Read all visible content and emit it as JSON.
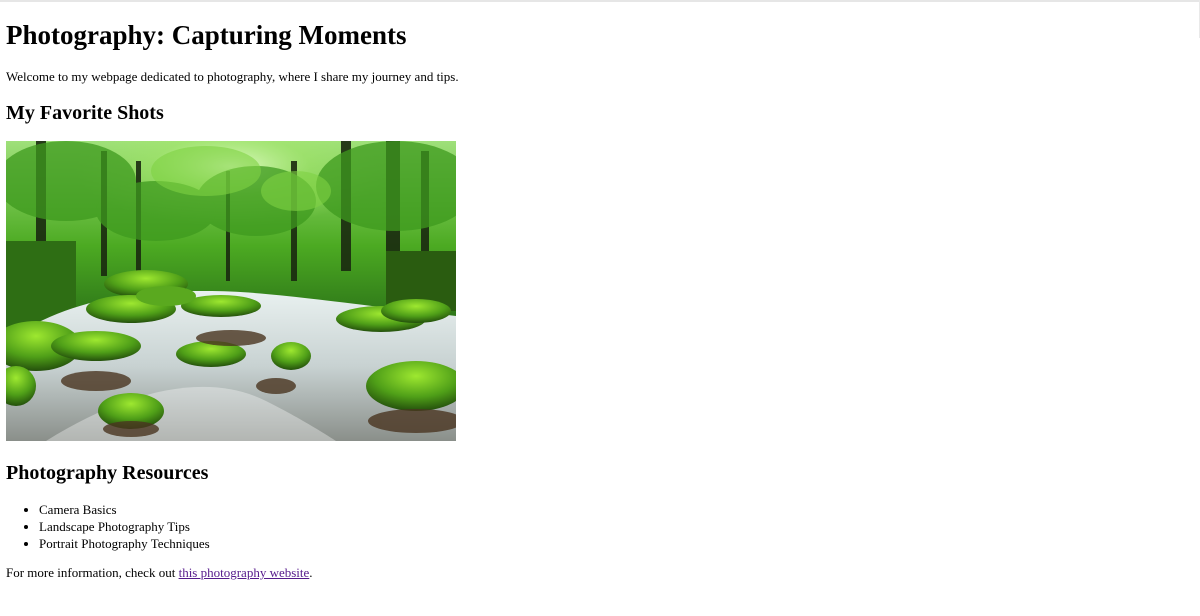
{
  "page": {
    "title": "Photography: Capturing Moments",
    "intro": "Welcome to my webpage dedicated to photography, where I share my journey and tips."
  },
  "favorites": {
    "heading": "My Favorite Shots",
    "image": {
      "subject": "forest-stream",
      "colors": {
        "canopy": "#2f8a1c",
        "light": "#b9f07a",
        "moss": "#5fb51e",
        "water": "#dfe7ea",
        "rock": "#4a3a25"
      }
    }
  },
  "resources": {
    "heading": "Photography Resources",
    "items": [
      "Camera Basics",
      "Landscape Photography Tips",
      "Portrait Photography Techniques"
    ]
  },
  "footer": {
    "prefix": "For more information, check out ",
    "link_text": "this photography website",
    "suffix": ".",
    "link_color": "#551a8b"
  }
}
